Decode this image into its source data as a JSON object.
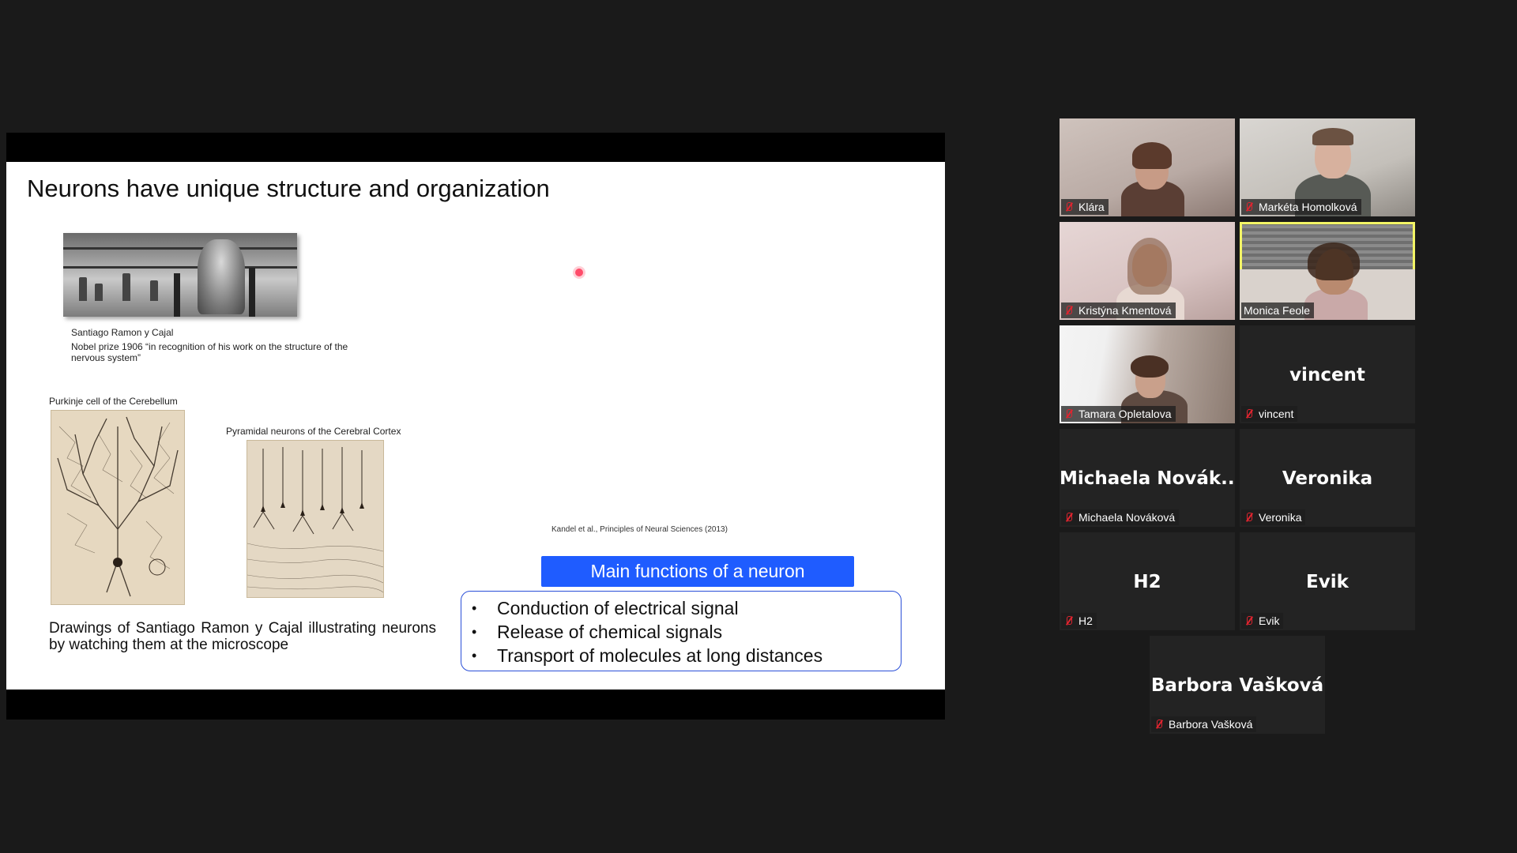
{
  "slide": {
    "title": "Neurons have unique structure and organization",
    "photo_caption_name": "Santiago Ramon y Cajal",
    "photo_caption_prize": "Nobel prize 1906 “in recognition of his work on the structure of the nervous system”",
    "purkinje_caption": "Purkinje cell of the Cerebellum",
    "pyramidal_caption": "Pyramidal neurons of the Cerebral Cortex",
    "citation": "Kandel et al., Principles of Neural Sciences (2013)",
    "description": "Drawings of Santiago Ramon y Cajal illustrating neurons by watching them at the microscope",
    "functions_title": "Main functions of a neuron",
    "functions": [
      "Conduction of electrical signal",
      "Release of chemical signals",
      "Transport of molecules at long distances"
    ]
  },
  "participants": [
    {
      "name": "Klára",
      "display": "",
      "video": true,
      "muted": true
    },
    {
      "name": "Markéta Homolková",
      "display": "",
      "video": true,
      "muted": true
    },
    {
      "name": "Kristýna Kmentová",
      "display": "",
      "video": true,
      "muted": true
    },
    {
      "name": "Monica Feole",
      "display": "",
      "video": true,
      "muted": false,
      "active_speaker": true
    },
    {
      "name": "Tamara Opletalova",
      "display": "",
      "video": true,
      "muted": true
    },
    {
      "name": "vincent",
      "display": "vincent",
      "video": false,
      "muted": true
    },
    {
      "name": "Michaela Nováková",
      "display": "Michaela Novák...",
      "video": false,
      "muted": true
    },
    {
      "name": "Veronika",
      "display": "Veronika",
      "video": false,
      "muted": true
    },
    {
      "name": "H2",
      "display": "H2",
      "video": false,
      "muted": true
    },
    {
      "name": "Evik",
      "display": "Evik",
      "video": false,
      "muted": true
    },
    {
      "name": "Barbora Vašková",
      "display": "Barbora Vašková",
      "video": false,
      "muted": true
    }
  ],
  "colors": {
    "background": "#1a1a1a",
    "active_speaker_border": "#f3f566",
    "mute_icon": "#e0242f",
    "functions_header": "#1f5cff"
  },
  "icons": {
    "muted_mic": "muted-mic-icon",
    "laser_pointer": "laser-pointer-icon"
  }
}
